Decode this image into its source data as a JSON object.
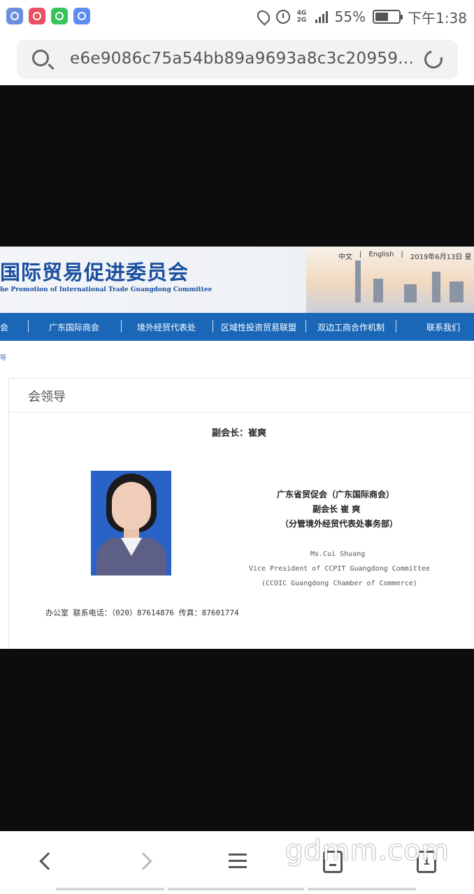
{
  "status_bar": {
    "network_top": "4G",
    "network_bottom": "2G",
    "battery": "55%",
    "time": "下午1:38",
    "icons": [
      "shield-icon",
      "music-icon",
      "wechat-icon",
      "browser-icon",
      "location-icon",
      "alarm-icon",
      "signal-icon",
      "battery-icon"
    ]
  },
  "address_bar": {
    "url": "e6e9086c75a54bb89a9693a8c3c20959..."
  },
  "site": {
    "title": "国际贸易促进委员会",
    "subtitle": "he Promotion of International Trade Guangdong Committee",
    "lang_cn": "中文",
    "lang_en": "English",
    "date": "2019年6月13日 星",
    "separator": "|",
    "nav": [
      "会",
      "广东国际商会",
      "境外经贸代表处",
      "区域性投资贸易联盟",
      "双边工商合作机制",
      "联系我们"
    ],
    "breadcrumb": "导",
    "panel_title": "会领导",
    "leader_title": "副会长：崔爽",
    "cn_org": "广东省贸促会（广东国际商会）",
    "cn_role": "副会长 崔 爽",
    "cn_dept": "（分管境外经贸代表处事务部）",
    "en_name": "Ms.Cui Shuang",
    "en_role": "Vice President of CCPIT Guangdong Committee",
    "en_org": "(CCOIC Guangdong Chamber of Commerce)",
    "contact": "办公室 联系电话：（020）87614876  传真：87601774"
  },
  "toolbar": {
    "back": "back",
    "forward": "forward",
    "menu": "menu",
    "page": "page",
    "tabs_count": "1"
  },
  "watermark": "gdmm.com"
}
